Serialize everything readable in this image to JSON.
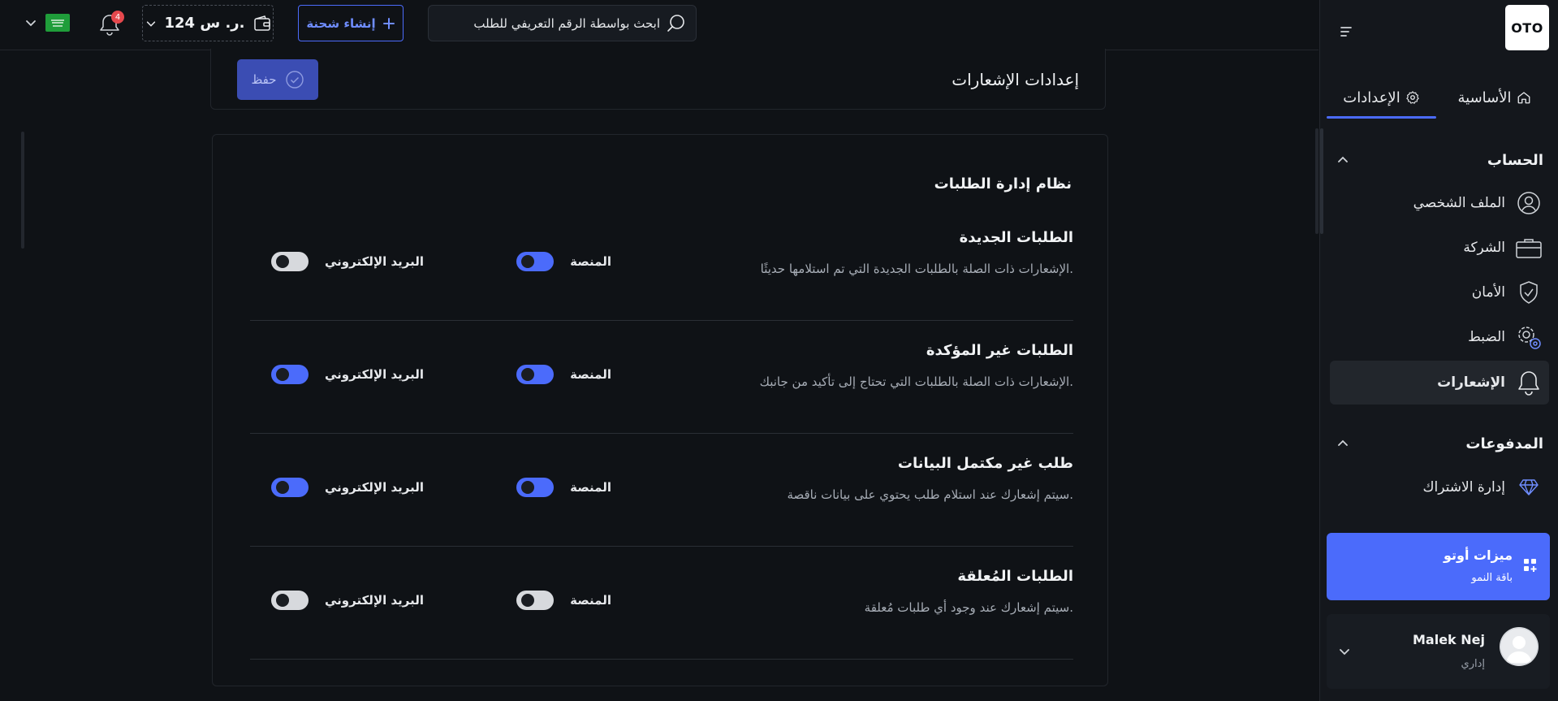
{
  "sidebar": {
    "logo": "OTO",
    "tabs": {
      "home": "الأساسية",
      "settings": "الإعدادات"
    },
    "account_section": "الحساب",
    "account_items": [
      {
        "label": "الملف الشخصي"
      },
      {
        "label": "الشركة"
      },
      {
        "label": "الأمان"
      },
      {
        "label": "الضبط"
      },
      {
        "label": "الإشعارات"
      }
    ],
    "payments_section": "المدفوعات",
    "payments_items": [
      {
        "label": "إدارة الاشتراك"
      }
    ],
    "feature_card": {
      "title": "ميزات أوتو",
      "subtitle": "باقة النمو"
    },
    "user": {
      "name": "Malek Nej",
      "role": "إداري"
    }
  },
  "topbar": {
    "search_placeholder": "ابحث بواسطة الرقم التعريفي للطلب",
    "create_shipment": "إنشاء شحنة",
    "wallet_amount": "124 ر. س.",
    "notifications_count": "4"
  },
  "main": {
    "title": "إعدادات الإشعارات",
    "save_label": "حفظ",
    "group_title": "نظام إدارة الطلبات",
    "platform_label": "المنصة",
    "email_label": "البريد الإلكتروني",
    "rows": [
      {
        "title": "الطلبات الجديدة",
        "desc": "الإشعارات ذات الصلة بالطلبات الجديدة التي تم استلامها حديثًا.",
        "platform": true,
        "email": false
      },
      {
        "title": "الطلبات غير المؤكدة",
        "desc": "الإشعارات ذات الصلة بالطلبات التي تحتاج إلى تأكيد من جانبك.",
        "platform": true,
        "email": true
      },
      {
        "title": "طلب غير مكتمل البيانات",
        "desc": "سيتم إشعارك عند استلام طلب يحتوي على بيانات ناقصة.",
        "platform": true,
        "email": true
      },
      {
        "title": "الطلبات المُعلقة",
        "desc": "سيتم إشعارك عند وجود أي طلبات مُعلقة.",
        "platform": false,
        "email": false
      }
    ]
  },
  "colors": {
    "accent": "#4b6bfb",
    "background": "#0f1216",
    "toggle_off": "#d7d9dd",
    "badge": "#e5484d"
  }
}
